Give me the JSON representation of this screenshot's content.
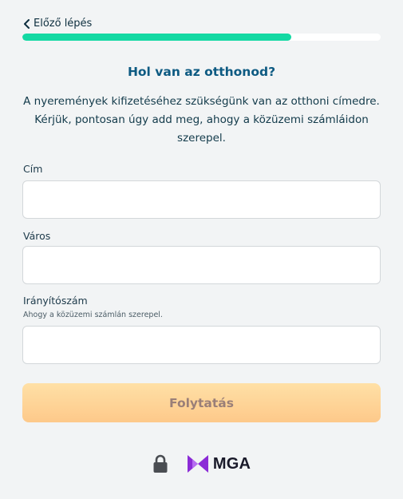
{
  "nav": {
    "back_label": "Előző lépés"
  },
  "progress": {
    "fraction": 0.75
  },
  "heading": {
    "title": "Hol van az otthonod?"
  },
  "intro": {
    "text": "A nyeremények kifizetéséhez szükségünk van az otthoni címedre. Kérjük, pontosan úgy add meg, ahogy a közüzemi számláidon szerepel."
  },
  "form": {
    "address": {
      "label": "Cím",
      "value": ""
    },
    "city": {
      "label": "Város",
      "value": ""
    },
    "zip": {
      "label": "Irányítószám",
      "hint": "Ahogy a közüzemi számlán szerepel.",
      "value": ""
    },
    "submit_label": "Folytatás"
  },
  "footer": {
    "lock_icon": "lock-icon",
    "logo_text": "MGA",
    "logo_color": "#8b2bd6"
  },
  "colors": {
    "accent": "#14d9a3",
    "title": "#0d5a82",
    "button_top": "#ffe0a6",
    "button_bottom": "#fdc98a"
  }
}
